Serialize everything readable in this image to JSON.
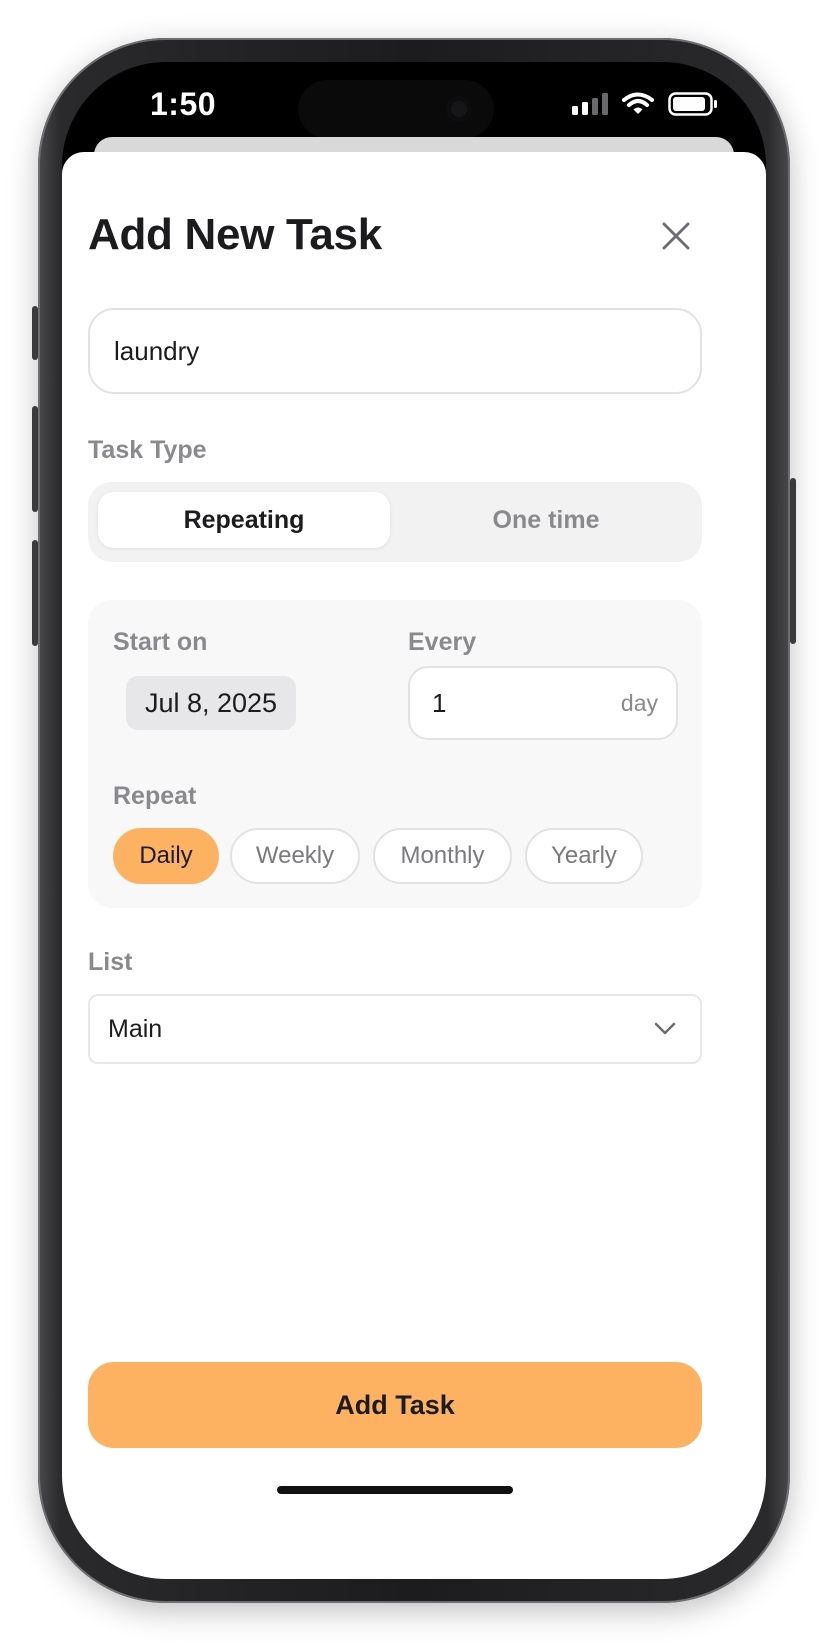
{
  "status_bar": {
    "time": "1:50"
  },
  "sheet": {
    "title": "Add New Task",
    "close_icon": "close-icon"
  },
  "task_name": {
    "value": "laundry",
    "placeholder": ""
  },
  "task_type": {
    "label": "Task Type",
    "options": [
      "Repeating",
      "One time"
    ],
    "selected": "Repeating"
  },
  "schedule": {
    "start_label": "Start on",
    "start_date": "Jul 8, 2025",
    "every_label": "Every",
    "every_value": "1",
    "every_unit": "day",
    "repeat_label": "Repeat",
    "repeat_options": [
      "Daily",
      "Weekly",
      "Monthly",
      "Yearly"
    ],
    "repeat_selected": "Daily"
  },
  "list": {
    "label": "List",
    "selected": "Main",
    "chevron_icon": "chevron-down-icon"
  },
  "submit": {
    "label": "Add Task"
  },
  "colors": {
    "accent": "#fdb261",
    "text": "#1c1c1e",
    "muted": "#8a8a8e",
    "border": "#e2e2e4"
  }
}
